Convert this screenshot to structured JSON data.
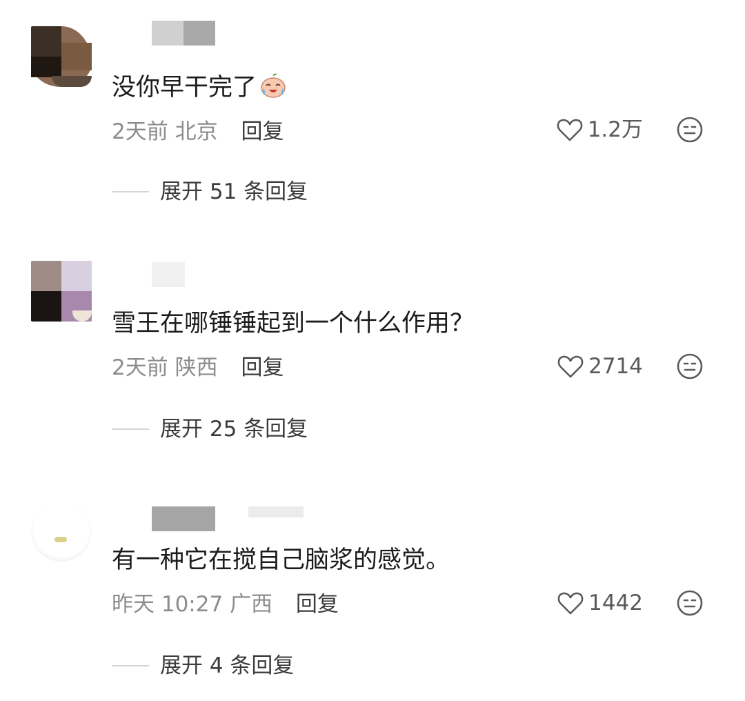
{
  "comments": [
    {
      "content": "没你早干完了",
      "emoji_icon": "crying-laughing-face-icon",
      "time": "2天前",
      "location": "北京",
      "reply_label": "回复",
      "likes": "1.2万",
      "expand_label": "展开 51 条回复"
    },
    {
      "content": "雪王在哪锤锤起到一个什么作用？",
      "time": "2天前",
      "location": "陕西",
      "reply_label": "回复",
      "likes": "2714",
      "expand_label": "展开 25 条回复"
    },
    {
      "content": "有一种它在搅自己脑浆的感觉。",
      "time": "昨天 10:27",
      "location": "广西",
      "reply_label": "回复",
      "likes": "1442",
      "expand_label": "展开 4 条回复"
    }
  ],
  "icons": {
    "like": "heart-outline-icon",
    "dislike": "neutral-face-icon"
  },
  "colors": {
    "text_primary": "#1c1c1c",
    "text_secondary": "#8c8c8c",
    "icon": "#5a5a5a"
  }
}
